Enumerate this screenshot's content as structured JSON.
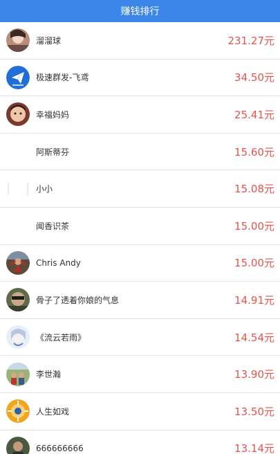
{
  "header": {
    "title": "赚钱排行"
  },
  "ranking": [
    {
      "name": "溜溜球",
      "amount": "231.27元",
      "avatar_icon": "avatar-photo-icon"
    },
    {
      "name": "极速群发-飞鸢",
      "amount": "34.50元",
      "avatar_icon": "paper-plane-logo-icon"
    },
    {
      "name": "幸福妈妈",
      "amount": "25.41元",
      "avatar_icon": "avatar-photo-icon"
    },
    {
      "name": "阿斯蒂芬",
      "amount": "15.60元",
      "avatar_icon": ""
    },
    {
      "name": "小小",
      "amount": "15.08元",
      "avatar_icon": "avatar-placeholder-icon"
    },
    {
      "name": "闻香识茶",
      "amount": "15.00元",
      "avatar_icon": ""
    },
    {
      "name": "Chris Andy",
      "amount": "15.00元",
      "avatar_icon": "avatar-photo-icon"
    },
    {
      "name": "骨子了透着你娘的气息",
      "amount": "14.91元",
      "avatar_icon": "avatar-photo-icon"
    },
    {
      "name": "《流云若雨》",
      "amount": "14.54元",
      "avatar_icon": "avatar-photo-icon"
    },
    {
      "name": "李世瀚",
      "amount": "13.90元",
      "avatar_icon": "avatar-photo-icon"
    },
    {
      "name": "人生如戏",
      "amount": "13.50元",
      "avatar_icon": "avatar-photo-icon"
    },
    {
      "name": "666666666",
      "amount": "13.14元",
      "avatar_icon": "avatar-photo-icon"
    }
  ],
  "colors": {
    "header_bg": "#3b86e8",
    "amount": "#e4534d",
    "divider": "#e3e3e3"
  }
}
